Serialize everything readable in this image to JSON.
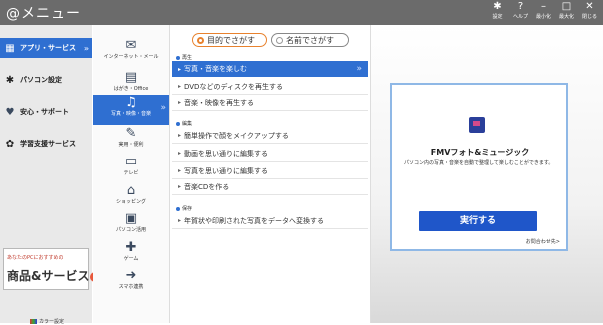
{
  "window": {
    "title": "@メニュー",
    "buttons": [
      {
        "icon": "gear-icon",
        "label": "設定"
      },
      {
        "icon": "help-icon",
        "label": "ヘルプ"
      },
      {
        "icon": "minimize-icon",
        "label": "最小化"
      },
      {
        "icon": "maximize-icon",
        "label": "最大化"
      },
      {
        "icon": "close-icon",
        "label": "閉じる"
      }
    ]
  },
  "sidebar": {
    "items": [
      {
        "label": "アプリ・サービス",
        "icon": "grid-icon",
        "active": true
      },
      {
        "label": "パソコン設定",
        "icon": "gear-icon"
      },
      {
        "label": "安心・サポート",
        "icon": "heart-icon"
      },
      {
        "label": "学習支援サービス",
        "icon": "book-icon"
      }
    ],
    "banner": {
      "line1": "あなたのPCにおすすめの",
      "line2": "商品&サービス",
      "badge": "›"
    },
    "color_setting": "カラー設定"
  },
  "categories": [
    {
      "label": "インターネット・メール",
      "icon": "globe-mail-icon"
    },
    {
      "label": "はがき・Office",
      "icon": "document-icon"
    },
    {
      "label": "写真・映像・音楽",
      "icon": "photo-music-icon",
      "active": true
    },
    {
      "label": "実用・便利",
      "icon": "pencil-icon"
    },
    {
      "label": "テレビ",
      "icon": "tv-icon"
    },
    {
      "label": "ショッピング",
      "icon": "basket-icon"
    },
    {
      "label": "パソコン活用",
      "icon": "monitor-icon"
    },
    {
      "label": "ゲーム",
      "icon": "gamepad-icon"
    },
    {
      "label": "スマホ連携",
      "icon": "phone-link-icon"
    }
  ],
  "mode_toggle": {
    "purpose": "目的でさがす",
    "name": "名前でさがす",
    "selected": "purpose"
  },
  "sections": [
    {
      "title": "再生",
      "items": [
        "写真・音楽を楽しむ",
        "DVDなどのディスクを再生する",
        "音楽・映像を再生する"
      ]
    },
    {
      "title": "編集",
      "items": [
        "簡単操作で顔をメイクアップする",
        "動画を思い通りに編集する",
        "写真を思い通りに編集する",
        "音楽CDを作る"
      ]
    },
    {
      "title": "保存",
      "items": [
        "年賀状や印刷された写真をデータへ変換する"
      ]
    }
  ],
  "detail": {
    "app_name": "FMVフォト&ミュージック",
    "description": "パソコン内の写真・音楽を自動で整理して楽しむことができます。",
    "run_button": "実行する",
    "inquiry": "お問合わせ先>"
  },
  "colors": {
    "accent": "#2f6fd1",
    "titlebar": "#6b6b6b",
    "run_button": "#1f56c9",
    "toggle_selected": "#e8822e"
  }
}
